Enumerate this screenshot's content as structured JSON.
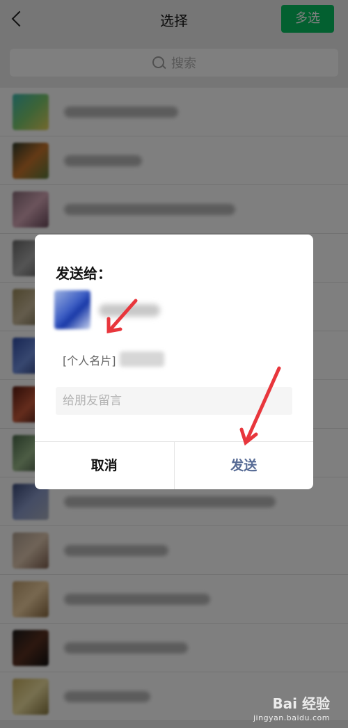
{
  "nav": {
    "title": "选择",
    "multi_select_label": "多选"
  },
  "search": {
    "placeholder": "搜索"
  },
  "dialog": {
    "title": "发送给：",
    "card_prefix": "[个人名片]",
    "message_placeholder": "给朋友留言",
    "cancel_label": "取消",
    "send_label": "发送"
  },
  "watermark": {
    "brand": "Bai 经验",
    "url": "jingyan.baidu.com"
  },
  "colors": {
    "primary_green": "#07c160",
    "send_blue": "#576b95",
    "arrow_red": "#e8363c"
  },
  "icons": {
    "back": "chevron-left-icon",
    "search": "search-icon",
    "watermark_logo": "paw-icon"
  }
}
